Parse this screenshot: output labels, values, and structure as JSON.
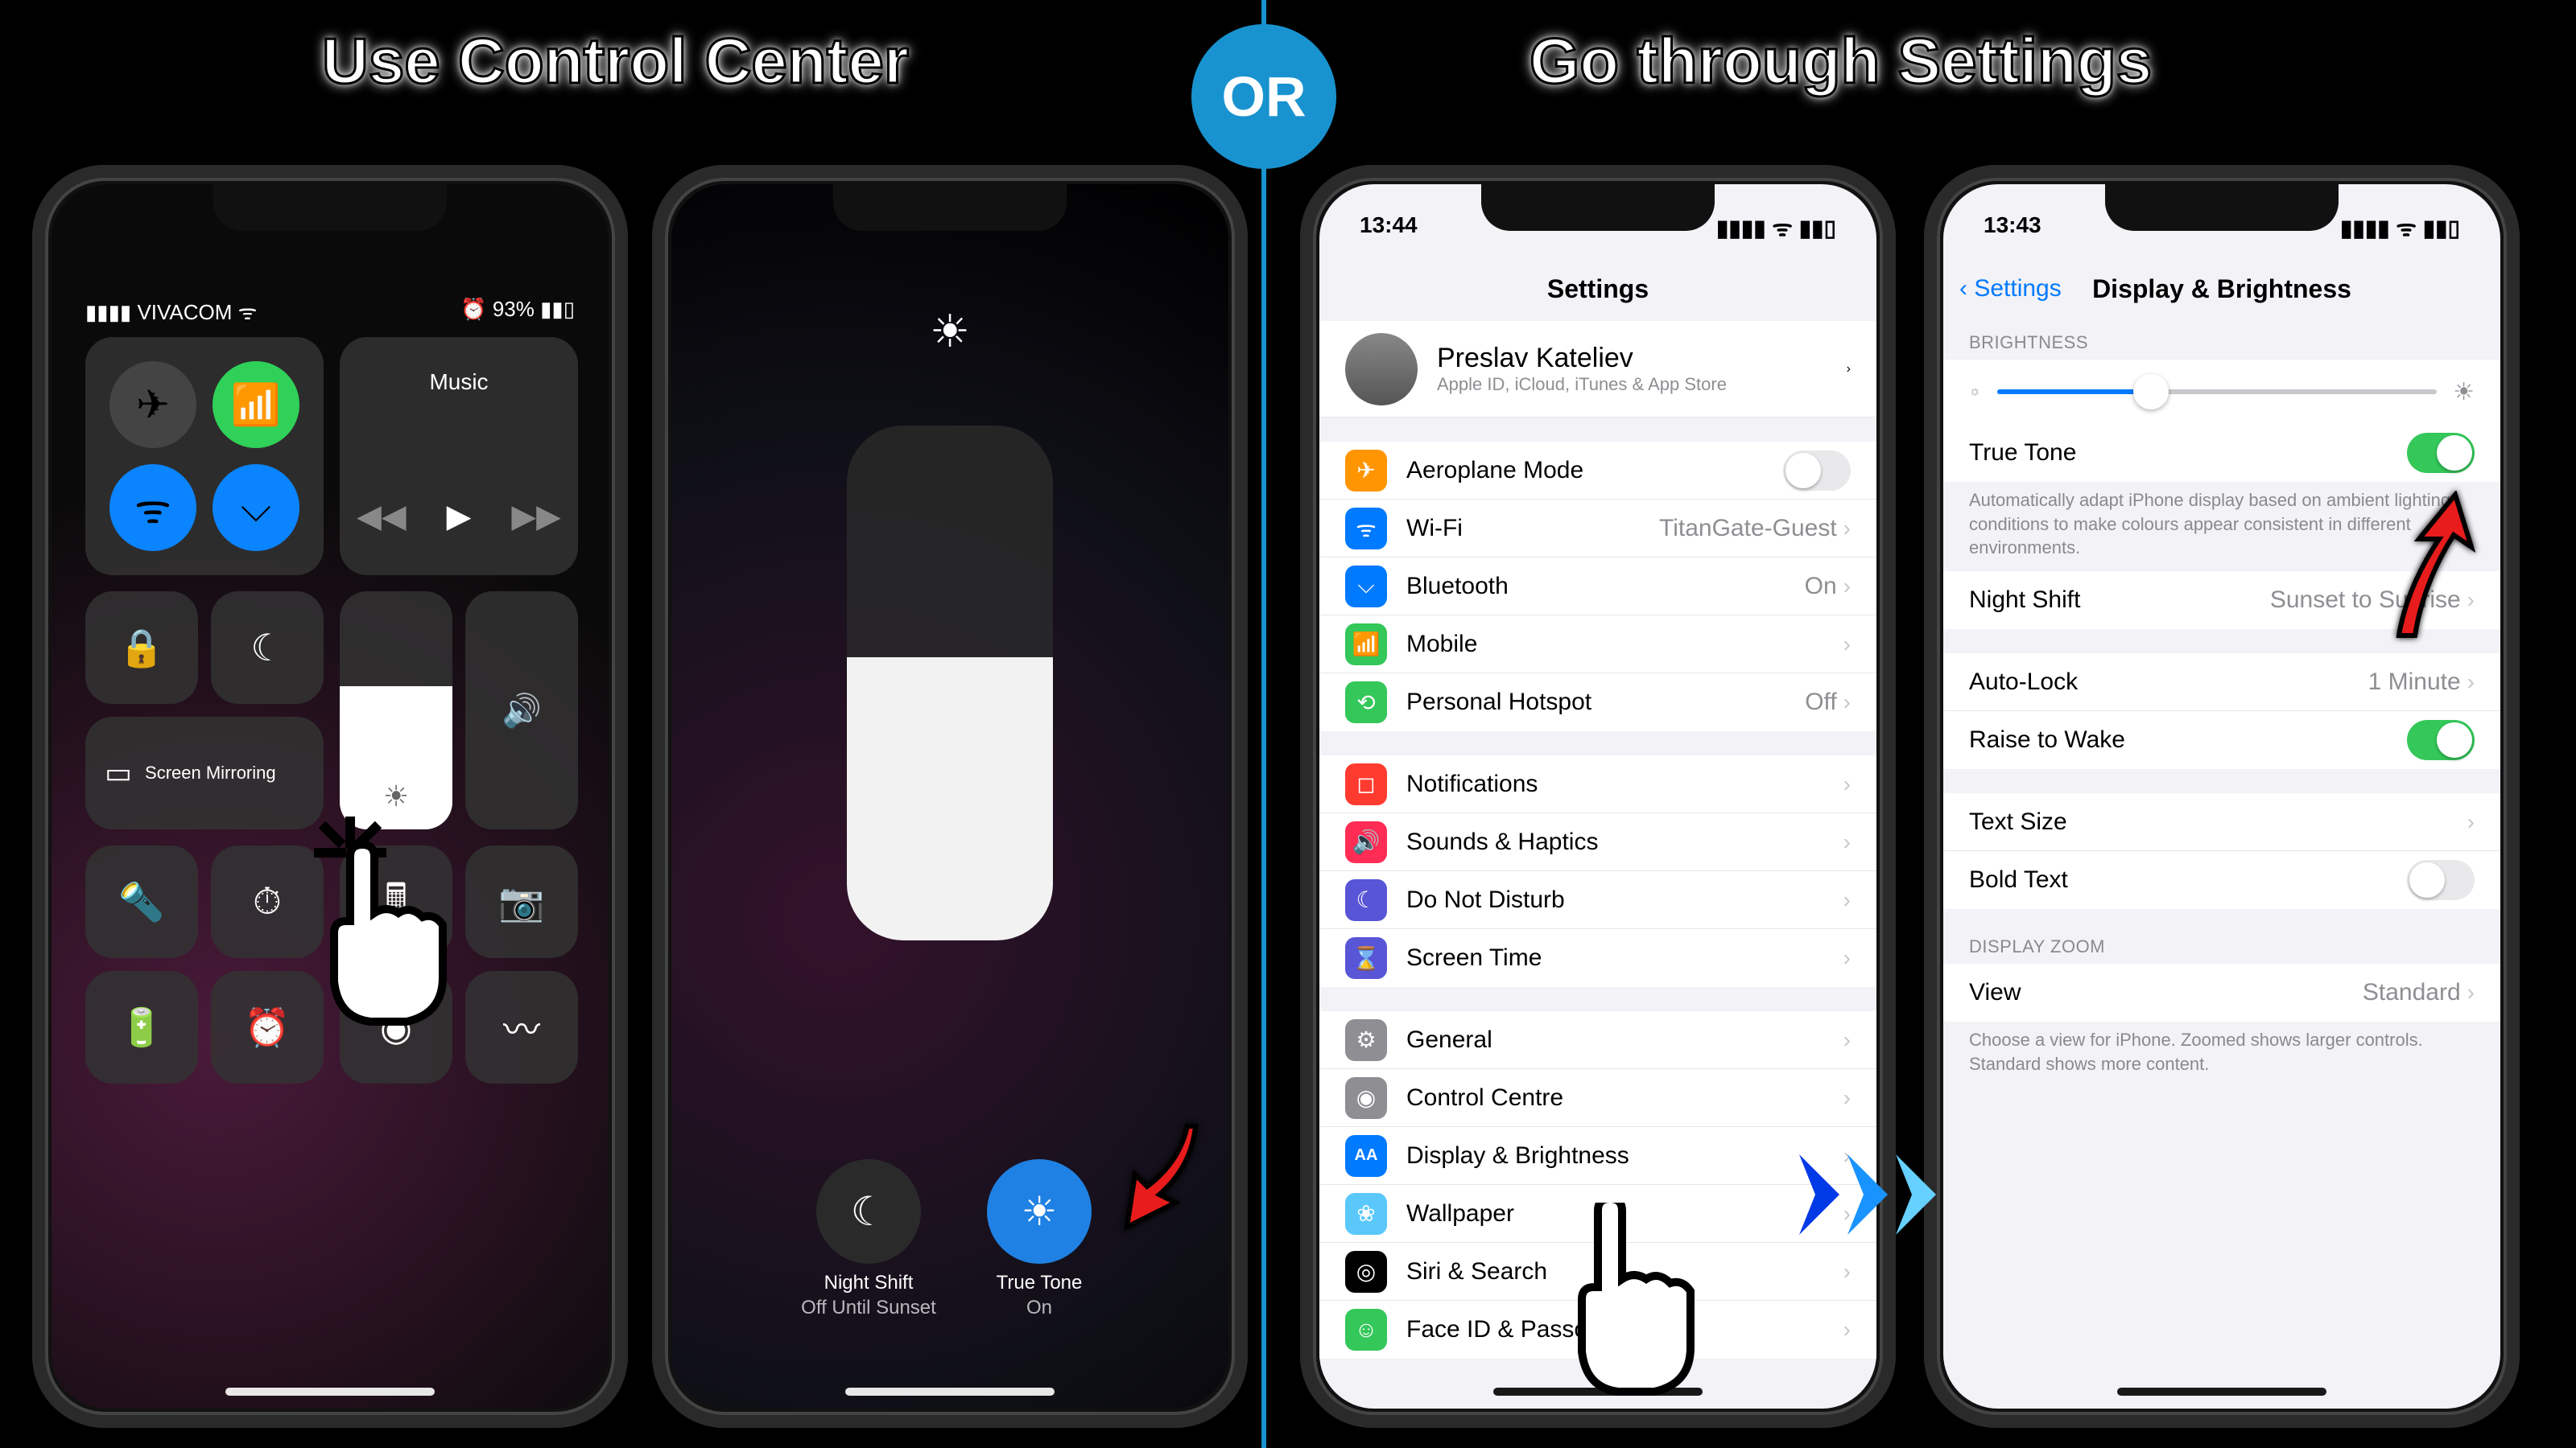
{
  "headings": {
    "left": "Use Control Center",
    "right": "Go through Settings",
    "or": "OR"
  },
  "phone1": {
    "status": {
      "carrier": "▮▮▮▮ VIVACOM ᯤ",
      "battery": "⏰ 93% ▮▮▯"
    },
    "connectivity": {
      "airplane": "✈",
      "cellular": "📶",
      "wifi": "ᯤ",
      "bluetooth": "⌵"
    },
    "music": {
      "title": "Music",
      "prev": "◀◀",
      "play": "▶",
      "next": "▶▶"
    },
    "tiles": {
      "orientation_lock": "🔒",
      "dnd_moon": "☾",
      "screen_mirroring_label": "Screen Mirroring",
      "screen_mirroring_icon": "▭",
      "brightness_icon": "☀",
      "volume_icon": "🔊"
    },
    "small": {
      "flashlight": "🔦",
      "timer": "⏱",
      "calculator": "🖩",
      "camera": "📷",
      "low_power": "🔋",
      "alarm": "⏰",
      "record": "◉",
      "sound": "〰"
    }
  },
  "phone2": {
    "sun": "☀",
    "night_shift": {
      "label": "Night Shift",
      "sub": "Off Until Sunset",
      "icon": "☾"
    },
    "true_tone": {
      "label": "True Tone",
      "sub": "On",
      "icon": "☀"
    }
  },
  "phone3": {
    "time": "13:44",
    "signals": "▮▮▮▮ ᯤ ▮▮▯",
    "title": "Settings",
    "profile": {
      "name": "Preslav Kateliev",
      "sub": "Apple ID, iCloud, iTunes & App Store"
    },
    "g1": [
      {
        "icon": "✈",
        "ic_bg": "#ff9500",
        "label": "Aeroplane Mode",
        "kind": "toggle",
        "on": false
      },
      {
        "icon": "ᯤ",
        "ic_bg": "#007aff",
        "label": "Wi-Fi",
        "val": "TitanGate-Guest"
      },
      {
        "icon": "⌵",
        "ic_bg": "#007aff",
        "label": "Bluetooth",
        "val": "On"
      },
      {
        "icon": "📶",
        "ic_bg": "#34c759",
        "label": "Mobile",
        "val": ""
      },
      {
        "icon": "⟲",
        "ic_bg": "#34c759",
        "label": "Personal Hotspot",
        "val": "Off"
      }
    ],
    "g2": [
      {
        "icon": "◻",
        "ic_bg": "#ff3b30",
        "label": "Notifications"
      },
      {
        "icon": "🔊",
        "ic_bg": "#ff2d55",
        "label": "Sounds & Haptics"
      },
      {
        "icon": "☾",
        "ic_bg": "#5856d6",
        "label": "Do Not Disturb"
      },
      {
        "icon": "⌛",
        "ic_bg": "#5856d6",
        "label": "Screen Time"
      }
    ],
    "g3": [
      {
        "icon": "⚙",
        "ic_bg": "#8e8e93",
        "label": "General"
      },
      {
        "icon": "◉",
        "ic_bg": "#8e8e93",
        "label": "Control Centre"
      },
      {
        "icon": "AA",
        "ic_bg": "#007aff",
        "label": "Display & Brightness"
      },
      {
        "icon": "❀",
        "ic_bg": "#5ac8fa",
        "label": "Wallpaper"
      },
      {
        "icon": "◎",
        "ic_bg": "#000",
        "label": "Siri & Search"
      },
      {
        "icon": "☺",
        "ic_bg": "#34c759",
        "label": "Face ID & Passcode"
      }
    ]
  },
  "phone4": {
    "time": "13:43",
    "signals": "▮▮▮▮ ᯤ ▮▮▯",
    "back": "Settings",
    "title": "Display & Brightness",
    "sec_brightness": "Brightness",
    "true_tone": {
      "label": "True Tone",
      "desc": "Automatically adapt iPhone display based on ambient lighting conditions to make colours appear consistent in different environments."
    },
    "night_shift": {
      "label": "Night Shift",
      "val": "Sunset to Sunrise"
    },
    "auto_lock": {
      "label": "Auto-Lock",
      "val": "1 Minute"
    },
    "raise": {
      "label": "Raise to Wake"
    },
    "text_size": {
      "label": "Text Size"
    },
    "bold": {
      "label": "Bold Text"
    },
    "sec_zoom": "Display Zoom",
    "view": {
      "label": "View",
      "val": "Standard"
    },
    "zoom_desc": "Choose a view for iPhone. Zoomed shows larger controls. Standard shows more content.",
    "slider": {
      "small": "☼",
      "large": "☀"
    }
  }
}
